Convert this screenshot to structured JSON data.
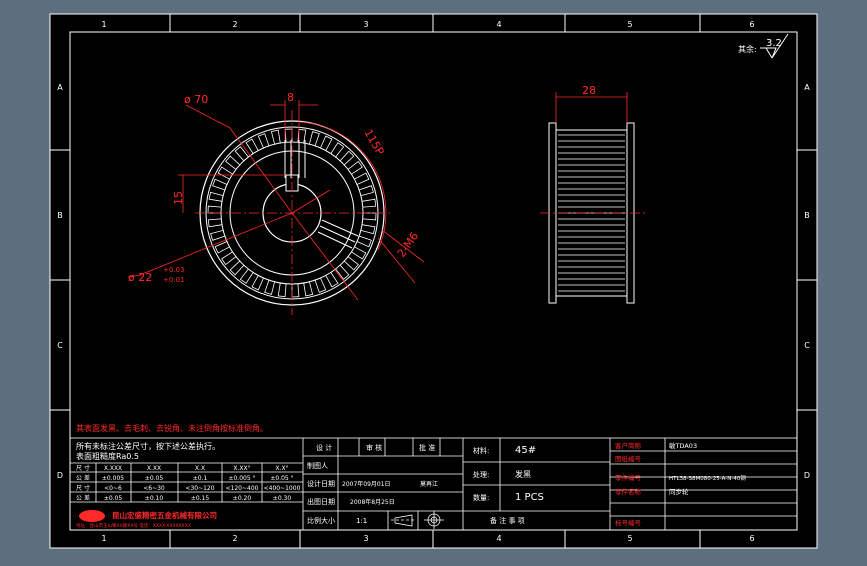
{
  "border": {
    "top_zones": [
      "1",
      "2",
      "3",
      "4",
      "5",
      "6"
    ],
    "bottom_zones": [
      "1",
      "2",
      "3",
      "4",
      "5",
      "6"
    ],
    "side_zones": [
      "A",
      "B",
      "C",
      "D"
    ]
  },
  "roughness": {
    "label": "其余:",
    "value": "3.2"
  },
  "front_view": {
    "outer_dia": "ø 70",
    "key_width": "8",
    "keyway_depth": "15",
    "bore_dia": "ø 22",
    "bore_tol_upper": "+0.03",
    "bore_tol_lower": "+0.01",
    "teeth": "115P",
    "tapped": "2-M6"
  },
  "side_view": {
    "width": "28"
  },
  "notes": {
    "red_note": "其表面发黑、去毛刺、去锐角、未注倒角按标准倒角。",
    "general_tol_title": "所有未标注公差尺寸，按下述公差执行。",
    "general_tol_sub": "表面粗糙度Ra0.5"
  },
  "tol_table": {
    "header": [
      "尺 寸",
      "X.XXX",
      "X.XX",
      "X.X",
      "X.XX°",
      "X.X°"
    ],
    "rows": [
      [
        "公 差",
        "±0.005",
        "±0.05",
        "±0.1",
        "±0.005 °",
        "±0.05 °"
      ],
      [
        "尺 寸",
        "<0~6",
        "<6~30",
        "<30~120",
        "<120~400",
        "<400~1000"
      ],
      [
        "公 差",
        "±0.05",
        "±0.10",
        "±0.15",
        "±0.20",
        "±0.30"
      ]
    ]
  },
  "company": {
    "name": "昆山宏盛精密五金机械有限公司",
    "address": "地址：昆山市玉山镇XX路XX号 电话：XXXX-XXXXXXXX"
  },
  "signoff": {
    "design": "设 计",
    "review": "审 核",
    "approve": "批 准",
    "drafter_label": "制图人",
    "drafter_value": "",
    "design_date_label": "设计日期",
    "design_date_value": "2007年09月01日",
    "designer_name": "莫再江",
    "issue_date_label": "出图日期",
    "issue_date_value": "2008年8月25日",
    "scale_label": "比例大小",
    "scale_value": "1:1"
  },
  "material": {
    "material_label": "材料:",
    "material_value": "45#",
    "finish_label": "处理:",
    "finish_value": "发黑",
    "qty_label": "数量:",
    "qty_value": "1 PCS",
    "notes_label": "备 注 事 项"
  },
  "title_block": {
    "client_label": "客户简称",
    "client_value": "敏TDA03",
    "drawno_label": "图纸编号",
    "drawno_value": "",
    "partno_label": "零件编号",
    "partno_value": "HTL38-S8M080-25-A-N-40钢",
    "partname_label": "零件名称",
    "partname_value": "同步轮",
    "mark_label": "标号编号",
    "mark_value": ""
  }
}
